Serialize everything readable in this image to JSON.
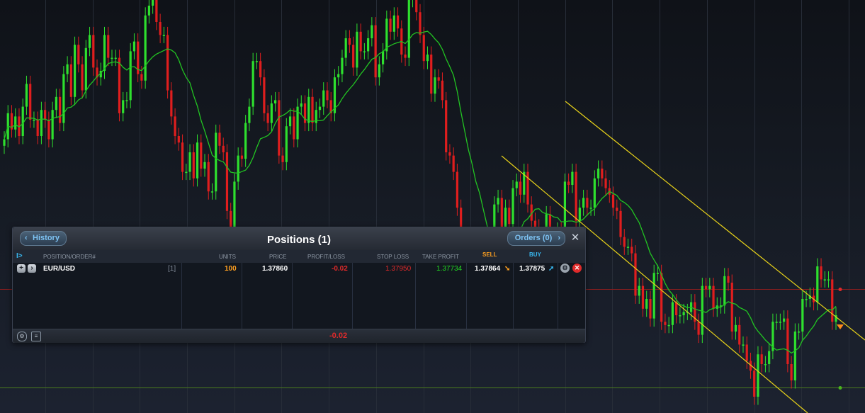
{
  "colors": {
    "background": "#141821",
    "up_candle": "#2ee02e",
    "down_candle": "#e01e1e",
    "moving_average": "#22c422",
    "channel": "#e8d21a",
    "sell_line": "#8a1e1e",
    "stop_line": "#4a7a1e"
  },
  "chart_data": {
    "type": "candlestick",
    "closes": [
      79,
      87,
      82,
      86,
      80,
      89,
      96,
      85,
      85,
      80,
      88,
      85,
      79,
      88,
      92,
      84,
      99,
      102,
      92,
      108,
      102,
      94,
      107,
      111,
      101,
      98,
      100,
      111,
      104,
      104,
      104,
      87,
      91,
      91,
      106,
      109,
      99,
      97,
      117,
      120,
      127,
      115,
      111,
      111,
      94,
      86,
      80,
      78,
      69,
      69,
      75,
      67,
      78,
      70,
      72,
      63,
      63,
      81,
      77,
      75,
      57,
      49,
      66,
      74,
      73,
      84,
      89,
      103,
      103,
      98,
      87,
      84,
      90,
      91,
      74,
      72,
      83,
      86,
      79,
      89,
      90,
      84,
      92,
      84,
      88,
      89,
      94,
      91,
      87,
      98,
      99,
      104,
      110,
      108,
      101,
      112,
      106,
      106,
      110,
      114,
      98,
      102,
      106,
      116,
      112,
      117,
      113,
      105,
      104,
      122,
      126,
      118,
      111,
      103,
      105,
      93,
      98,
      97,
      91,
      75,
      74,
      69,
      58,
      43,
      44,
      37,
      44,
      36,
      47,
      34,
      34,
      40,
      59,
      61,
      51,
      58,
      53,
      64,
      66,
      62,
      69,
      59,
      54,
      52,
      42,
      44,
      56,
      48,
      48,
      51,
      47,
      66,
      65,
      69,
      54,
      58,
      61,
      58,
      58,
      67,
      70,
      67,
      64,
      62,
      58,
      57,
      49,
      46,
      46,
      44,
      31,
      34,
      27,
      30,
      24,
      38,
      38,
      23,
      22,
      22,
      29,
      25,
      25,
      26,
      26,
      29,
      23,
      19,
      34,
      33,
      34,
      27,
      28,
      28,
      37,
      35,
      20,
      22,
      16,
      16,
      11,
      8,
      0,
      13,
      10,
      10,
      14,
      23,
      23,
      23,
      24,
      10,
      5,
      20,
      20,
      30,
      30,
      31,
      29,
      40,
      36,
      36,
      36,
      23,
      25
    ],
    "series_line": {
      "name": "moving-average"
    },
    "horizontal_levels": [
      "sell",
      "stop"
    ]
  },
  "panel": {
    "title": "Positions (1)",
    "history_label": "History",
    "orders_label": "Orders (0)",
    "close_glyph": "✕",
    "collapse_glyph": "I>",
    "columns": {
      "position": "POSITION/ORDER#",
      "units": "UNITS",
      "price": "PRICE",
      "pl": "PROFIT/LOSS",
      "stop": "STOP LOSS",
      "tp": "TAKE PROFIT",
      "sell": "SELL",
      "buy": "BUY"
    },
    "row": {
      "symbol": "EUR/USD",
      "count": "[1]",
      "units": "100",
      "price": "1.37860",
      "pl": "-0.02",
      "stop": "1.37950",
      "tp": "1.37734",
      "sell": "1.37864",
      "buy": "1.37875"
    },
    "total": "-0.02"
  }
}
